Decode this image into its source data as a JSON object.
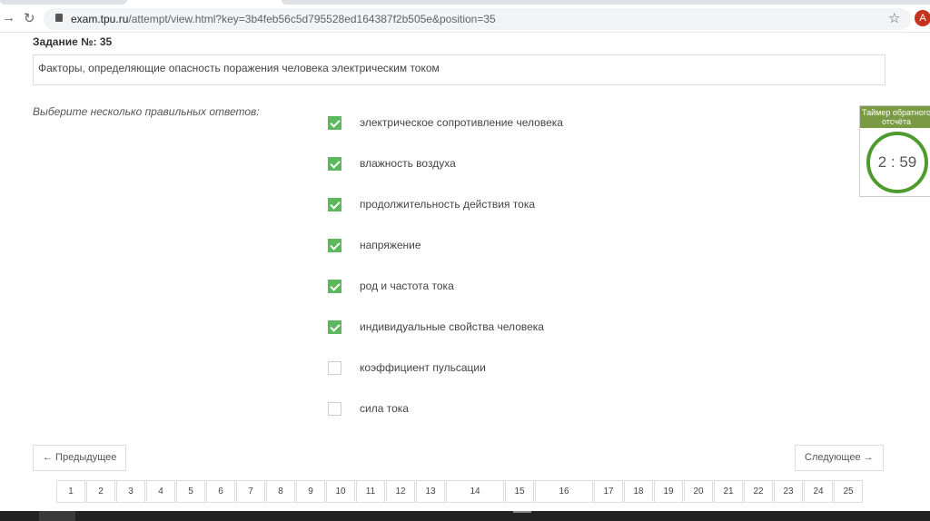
{
  "browser": {
    "url_host": "exam.tpu.ru",
    "url_path": "/attempt/view.html?key=3b4feb56c5d795528ed164387f2b505e&position=35",
    "avatar_letter": "A"
  },
  "task": {
    "label": "Задание №:  35",
    "question": "Факторы, определяющие опасность поражения человека электрическим током",
    "hint": "Выберите несколько правильных ответов:"
  },
  "options": [
    {
      "label": "электрическое сопротивление человека",
      "checked": true
    },
    {
      "label": "влажность воздуха",
      "checked": true
    },
    {
      "label": "продолжительность действия тока",
      "checked": true
    },
    {
      "label": "напряжение",
      "checked": true
    },
    {
      "label": "род и частота тока",
      "checked": true
    },
    {
      "label": "индивидуальные свойства человека",
      "checked": true
    },
    {
      "label": "коэффициент пульсации",
      "checked": false
    },
    {
      "label": "сила тока",
      "checked": false
    }
  ],
  "timer": {
    "title": "Таймер обратного отсчёта",
    "value": "2 : 59"
  },
  "nav": {
    "prev": "← Предыдущее",
    "next": "Следующее →"
  },
  "pages": [
    "1",
    "2",
    "3",
    "4",
    "5",
    "6",
    "7",
    "8",
    "9",
    "10",
    "11",
    "12",
    "13",
    "14",
    "15",
    "16",
    "17",
    "18",
    "19",
    "20",
    "21",
    "22",
    "23",
    "24",
    "25"
  ],
  "colors": {
    "check": "#5cb85c",
    "timer_header": "#7a9a44",
    "timer_ring": "#4e9a2e"
  }
}
